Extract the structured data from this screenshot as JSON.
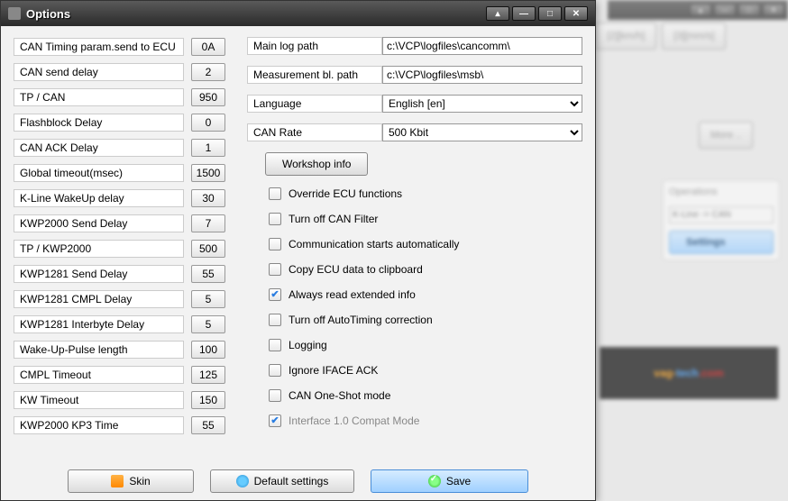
{
  "dialog": {
    "title": "Options",
    "params": [
      {
        "label": "CAN Timing param.send to ECU",
        "value": "0A"
      },
      {
        "label": "CAN send delay",
        "value": "2"
      },
      {
        "label": "TP / CAN",
        "value": "950"
      },
      {
        "label": "Flashblock Delay",
        "value": "0"
      },
      {
        "label": "CAN ACK Delay",
        "value": "1"
      },
      {
        "label": "Global timeout(msec)",
        "value": "1500"
      },
      {
        "label": "K-Line WakeUp delay",
        "value": "30"
      },
      {
        "label": "KWP2000 Send Delay",
        "value": "7"
      },
      {
        "label": "TP / KWP2000",
        "value": "500"
      },
      {
        "label": "KWP1281 Send Delay",
        "value": "55"
      },
      {
        "label": "KWP1281 CMPL Delay",
        "value": "5"
      },
      {
        "label": "KWP1281 Interbyte Delay",
        "value": "5"
      },
      {
        "label": "Wake-Up-Pulse length",
        "value": "100"
      },
      {
        "label": "CMPL Timeout",
        "value": "125"
      },
      {
        "label": "KW Timeout",
        "value": "150"
      },
      {
        "label": "KWP2000 KP3 Time",
        "value": "55"
      }
    ],
    "fields": {
      "main_log_path": {
        "label": "Main log path",
        "value": "c:\\VCP\\logfiles\\cancomm\\"
      },
      "meas_path": {
        "label": "Measurement bl. path",
        "value": "c:\\VCP\\logfiles\\msb\\"
      },
      "language": {
        "label": "Language",
        "value": "English [en]"
      },
      "can_rate": {
        "label": "CAN Rate",
        "value": "500 Kbit"
      }
    },
    "workshop_btn": "Workshop info",
    "checks": [
      {
        "label": "Override ECU functions",
        "checked": false,
        "disabled": false
      },
      {
        "label": "Turn off CAN Filter",
        "checked": false,
        "disabled": false
      },
      {
        "label": "Communication starts automatically",
        "checked": false,
        "disabled": false
      },
      {
        "label": "Copy ECU data to clipboard",
        "checked": false,
        "disabled": false
      },
      {
        "label": "Always read extended info",
        "checked": true,
        "disabled": false
      },
      {
        "label": "Turn off AutoTiming correction",
        "checked": false,
        "disabled": false
      },
      {
        "label": "Logging",
        "checked": false,
        "disabled": false
      },
      {
        "label": "Ignore IFACE ACK",
        "checked": false,
        "disabled": false
      },
      {
        "label": "CAN One-Shot mode",
        "checked": false,
        "disabled": false
      },
      {
        "label": "Interface 1.0 Compat Mode",
        "checked": true,
        "disabled": true
      }
    ],
    "footer": {
      "skin": "Skin",
      "default": "Default settings",
      "save": "Save"
    }
  },
  "bg": {
    "btn1": "[2][km/h]",
    "btn2": "[3][mm/s]",
    "more": "More ..",
    "panel_title": "Operations",
    "select": "K-Line -> CAN",
    "settings": "Settings",
    "logo1": "vag-",
    "logo2": "tech",
    "logo3": ".com"
  }
}
